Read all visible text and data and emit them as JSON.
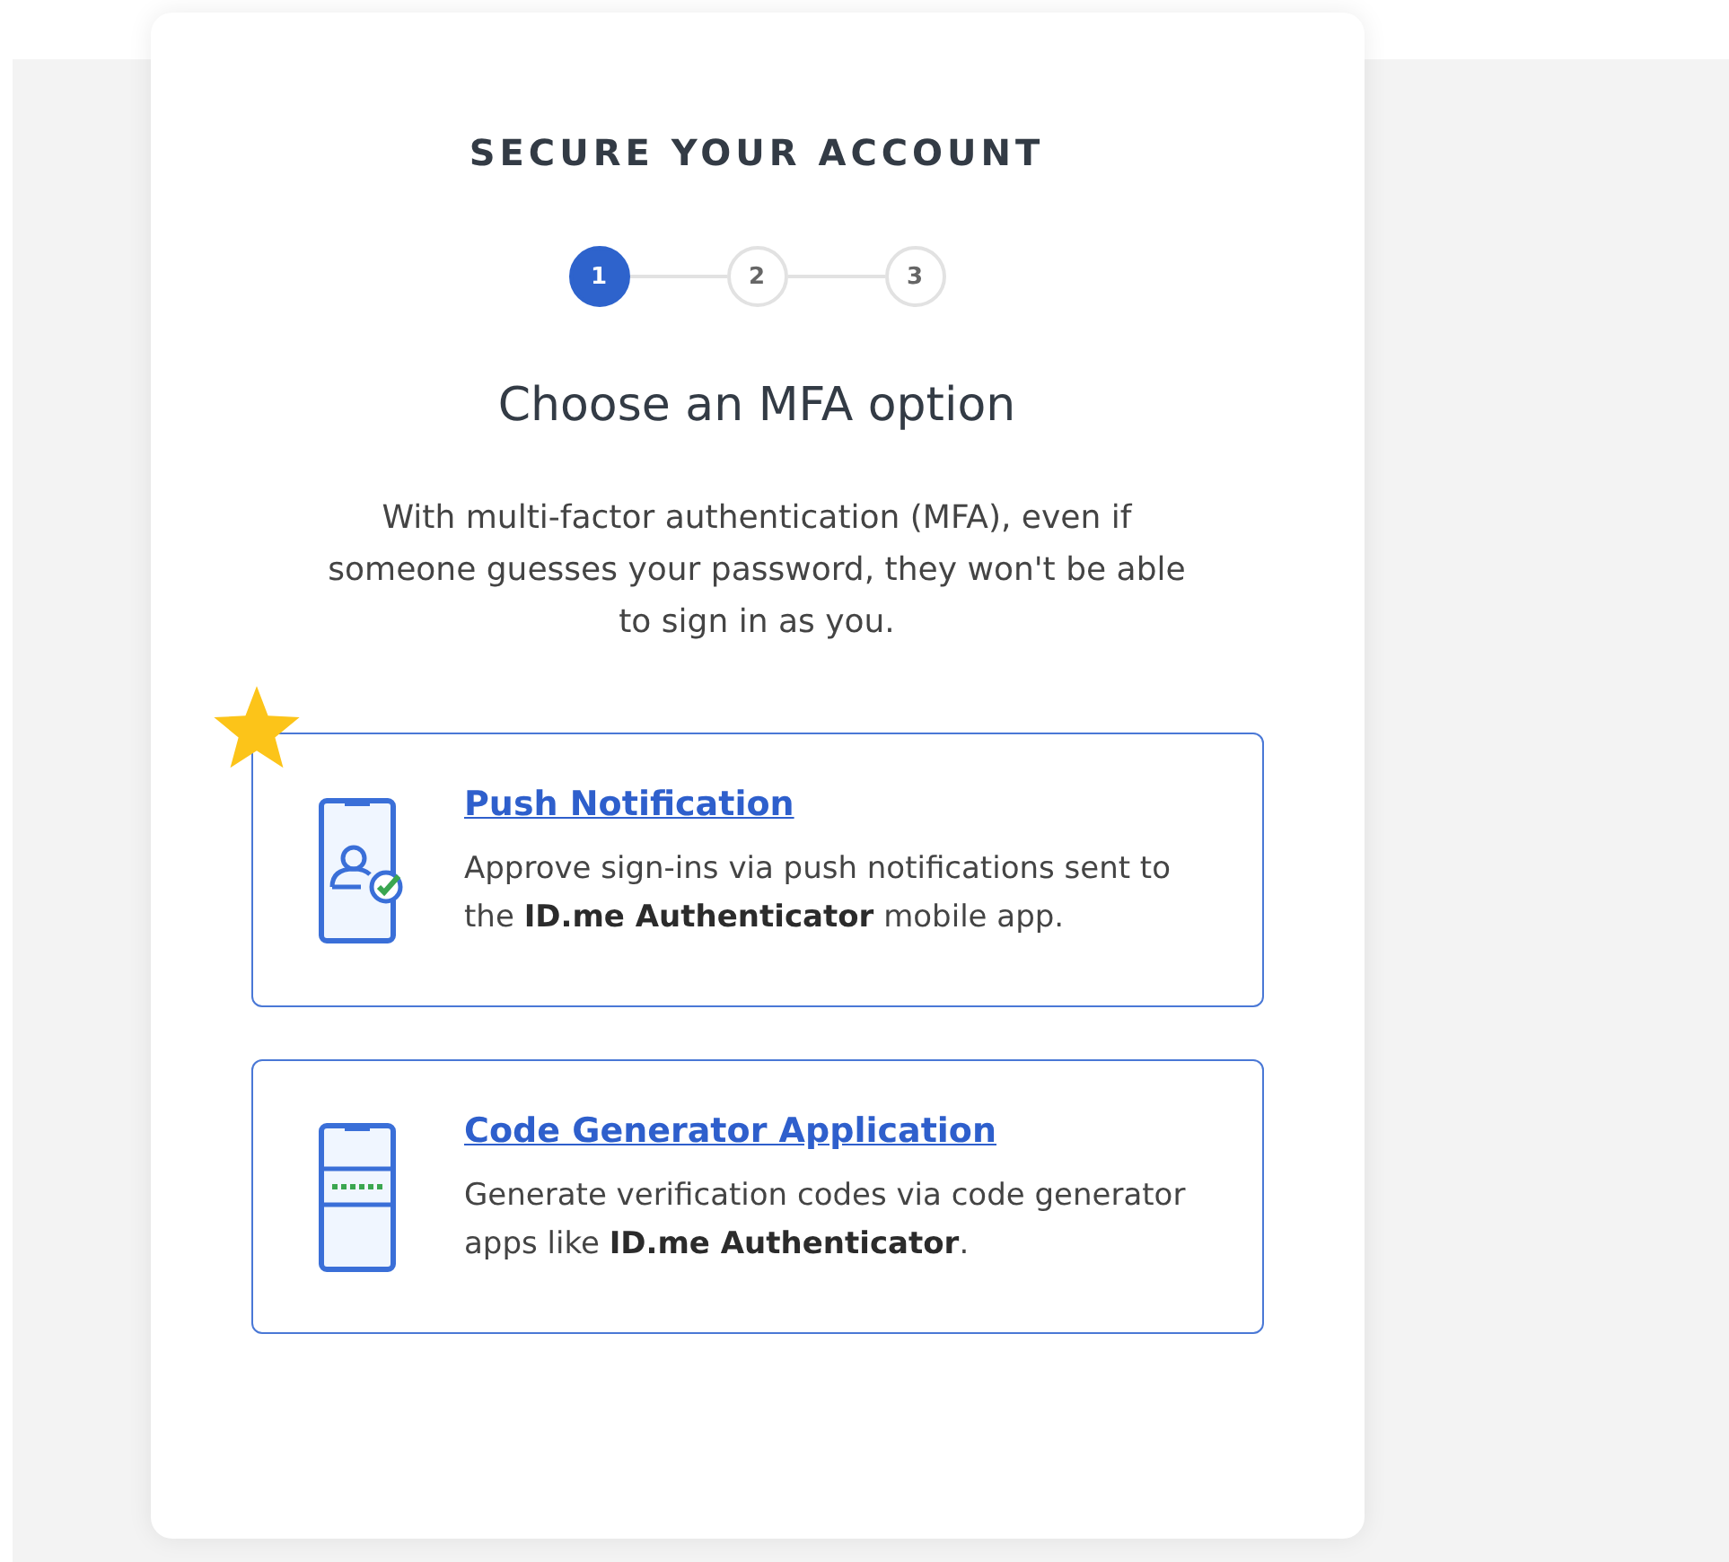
{
  "title": "SECURE YOUR ACCOUNT",
  "steps": [
    {
      "label": "1",
      "selected": true
    },
    {
      "label": "2",
      "selected": false
    },
    {
      "label": "3",
      "selected": false
    }
  ],
  "heading": "Choose an MFA option",
  "intro": "With multi-factor authentication (MFA), even if someone guesses your password, they won't be able to sign in as you.",
  "options": [
    {
      "kind": "push",
      "recommended": true,
      "title": "Push Notification",
      "description": "Approve sign-ins via push notifications sent to the **ID.me Authenticator** mobile app."
    },
    {
      "kind": "code",
      "recommended": false,
      "title": "Code Generator Application",
      "description": "Generate verification codes via code generator apps like **ID.me Authenticator**."
    }
  ]
}
